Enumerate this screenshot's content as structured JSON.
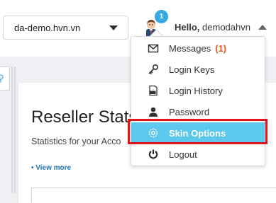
{
  "header": {
    "domain_selector": {
      "value": "da-demo.hvn.vn"
    },
    "notifications": {
      "count": "1"
    },
    "user": {
      "greeting": "Hello,",
      "username": "demodahvn"
    }
  },
  "user_menu": {
    "items": [
      {
        "label": "Messages",
        "badge": "(1)",
        "icon": "envelope-icon"
      },
      {
        "label": "Login Keys",
        "icon": "key-icon"
      },
      {
        "label": "Login History",
        "icon": "log-icon"
      },
      {
        "label": "Password",
        "icon": "user-silhouette-icon"
      },
      {
        "label": "Skin Options",
        "icon": "gear-icon",
        "active": true
      },
      {
        "label": "Logout",
        "icon": "power-icon"
      }
    ]
  },
  "main": {
    "title": "Reseller Stats",
    "subtitle": "Statistics for your Acco",
    "view_more": "• View more"
  },
  "colors": {
    "accent": "#36a9e1",
    "active_item": "#5bc8ec",
    "highlight_border": "#e6141b",
    "badge_text": "#e8561c",
    "link": "#1f73b7"
  }
}
